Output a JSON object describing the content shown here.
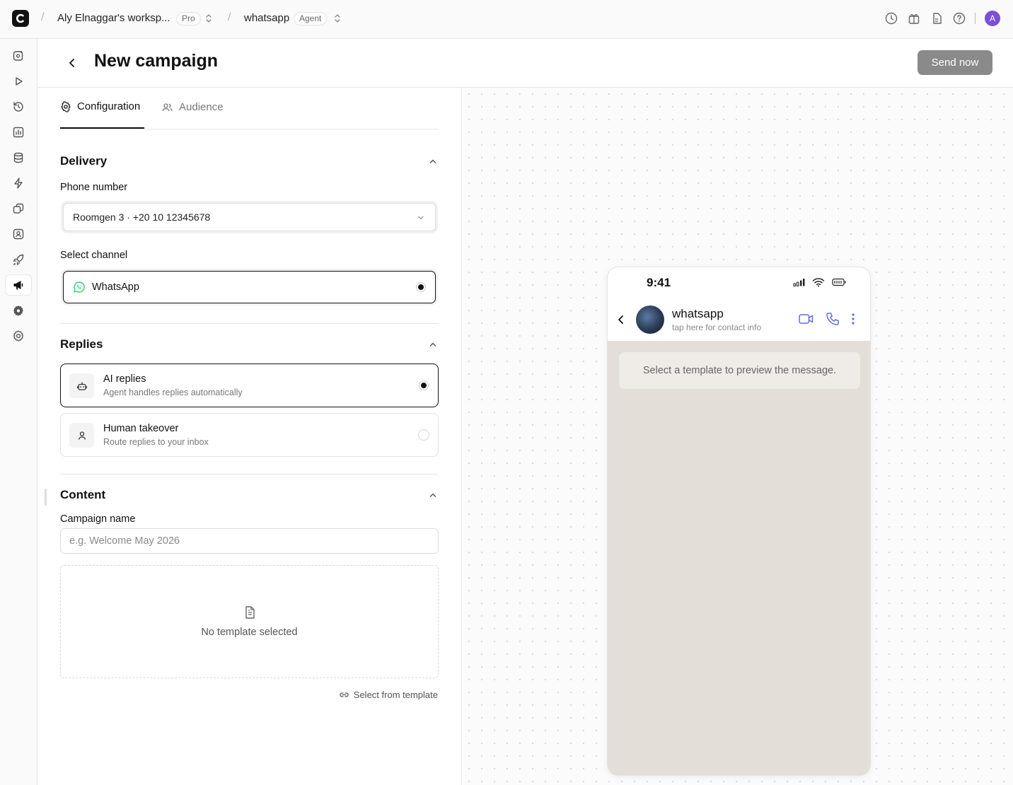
{
  "topbar": {
    "workspace": "Aly Elnaggar's worksp...",
    "workspace_badge": "Pro",
    "project": "whatsapp",
    "project_badge": "Agent",
    "separator": "/",
    "avatar_initial": "A"
  },
  "sidebar": {
    "icons": [
      "compose-icon",
      "play-icon",
      "history-icon",
      "analytics-icon",
      "database-icon",
      "sparkle-icon",
      "integrations-icon",
      "contacts-icon",
      "rocket-icon",
      "megaphone-icon",
      "plugin-gear-icon",
      "settings-icon"
    ],
    "active": "megaphone-icon"
  },
  "header": {
    "title": "New campaign",
    "send_label": "Send now"
  },
  "tabs": [
    {
      "label": "Configuration",
      "active": true
    },
    {
      "label": "Audience",
      "active": false
    }
  ],
  "delivery": {
    "title": "Delivery",
    "phone_label": "Phone number",
    "phone_value": "Roomgen 3 · +20 10 12345678",
    "channel_label": "Select channel",
    "channel_value": "WhatsApp"
  },
  "replies": {
    "title": "Replies",
    "options": [
      {
        "title": "AI replies",
        "subtitle": "Agent handles replies automatically",
        "selected": true
      },
      {
        "title": "Human takeover",
        "subtitle": "Route replies to your inbox",
        "selected": false
      }
    ]
  },
  "content": {
    "title": "Content",
    "name_label": "Campaign name",
    "name_placeholder": "e.g. Welcome May 2026",
    "name_value": "",
    "empty_template": "No template selected",
    "select_template": "Select from template"
  },
  "preview": {
    "time": "9:41",
    "contact_name": "whatsapp",
    "contact_sub": "tap here for contact info",
    "message": "Select a template to preview the message."
  },
  "colors": {
    "accent_blue": "#5b6ee1",
    "whatsapp_green": "#25d366",
    "avatar_purple": "#7b4fd6",
    "send_button": "#8a8a8a",
    "chat_background": "#e3dfd8"
  }
}
